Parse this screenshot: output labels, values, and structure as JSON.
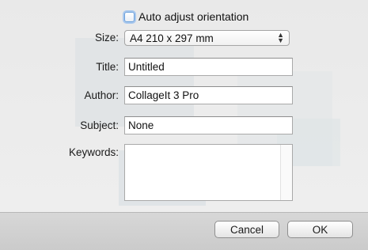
{
  "options": {
    "auto_adjust_label": "Auto adjust orientation",
    "auto_adjust_checked": false
  },
  "size": {
    "label": "Size:",
    "value": "A4 210 x 297 mm"
  },
  "title": {
    "label": "Title:",
    "value": "Untitled"
  },
  "author": {
    "label": "Author:",
    "value": "CollageIt 3 Pro"
  },
  "subject": {
    "label": "Subject:",
    "value": "None"
  },
  "keywords": {
    "label": "Keywords:",
    "value": ""
  },
  "buttons": {
    "cancel": "Cancel",
    "ok": "OK"
  },
  "icons": {
    "select_arrows": "up-down-chevron-icon"
  },
  "colors": {
    "focus_ring": "#a9c8ee",
    "footer_bg": "#d0d0d0"
  }
}
